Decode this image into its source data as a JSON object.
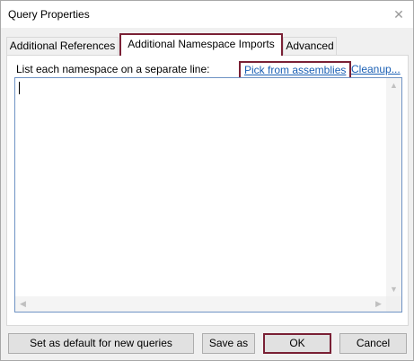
{
  "window": {
    "title": "Query Properties"
  },
  "tabs": [
    {
      "label": "Additional References"
    },
    {
      "label": "Additional Namespace Imports"
    },
    {
      "label": "Advanced"
    }
  ],
  "panel": {
    "instruction": "List each namespace on a separate line:",
    "link_pick": "Pick from assemblies",
    "link_cleanup": "Cleanup...",
    "editor_value": ""
  },
  "buttons": {
    "set_default": "Set as default for new queries",
    "save_as": "Save as",
    "ok": "OK",
    "cancel": "Cancel"
  },
  "icons": {
    "close": "close-icon",
    "scroll_up": "chevron-up-icon",
    "scroll_down": "chevron-down-icon",
    "scroll_left": "chevron-left-icon",
    "scroll_right": "chevron-right-icon"
  },
  "colors": {
    "highlight": "#7a2035",
    "link": "#1a5fb4"
  }
}
